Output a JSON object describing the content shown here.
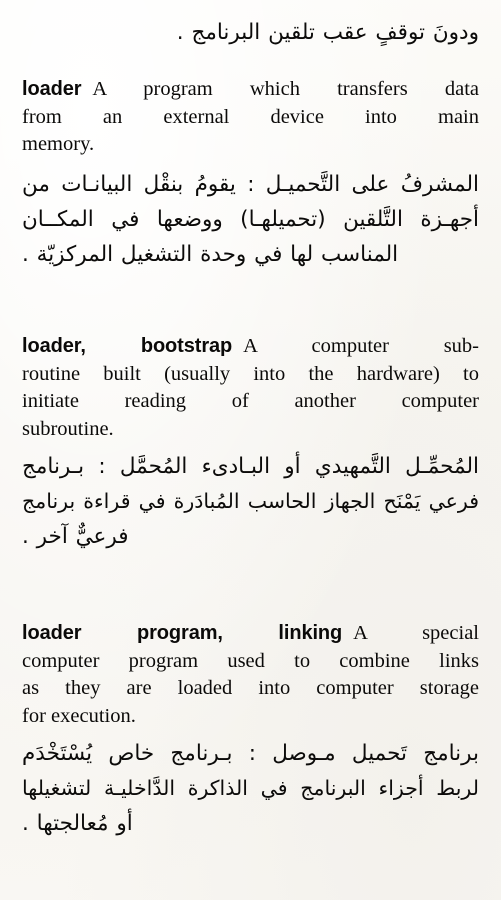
{
  "page": {
    "type": "bilingual-dictionary-page",
    "language_pair": "English-Arabic",
    "paper_color": "#f8f6f1",
    "ink_color": "#0b0a09"
  },
  "continuation": {
    "arabic_line": "ودونَ توقفٍ عقب تلقين البرنامج ."
  },
  "entries": [
    {
      "id": "loader",
      "headword": "loader",
      "english_lines": [
        "A program which transfers data",
        "from an external device into main",
        "memory."
      ],
      "english_text": "A program which transfers data from an external device into main memory.",
      "arabic_lines": [
        "المشرفُ على التَّحميـل : يقومُ بنقْل البيانـات من",
        "أجهـزة التَّلقين (تحميلهـا) ووضعها في المكــان",
        "المناسب لها في وحدة التشغيل المركزيّة ."
      ],
      "arabic_text": "المشرفُ على التَّحميل : يقومُ بنقْل البيانات من أجهزة التَّلقين (تحميلها) ووضعها في المكان المناسب لها في وحدة التشغيل المركزيّة ."
    },
    {
      "id": "loader-bootstrap",
      "headword": "loader, bootstrap",
      "english_lines": [
        "A computer sub-",
        "routine built (usually into the hardware) to",
        "initiate reading of another computer",
        "subroutine."
      ],
      "english_text": "A computer subroutine built (usually into the hardware) to initiate reading of another computer subroutine.",
      "arabic_lines": [
        "المُحمِّـل التَّمهيدي أو البـادىء المُحمَّل : بـرنامج",
        "فرعي يَمْنَح الجهاز الحاسب المُبادَرة في قراءة برنامج",
        "فرعيٌّ آخر ."
      ],
      "arabic_text": "المُحمِّل التَّمهيدي أو البادىء المُحمَّل : برنامج فرعي يَمْنَح الجهاز الحاسب المُبادَرة في قراءة برنامج فرعيٌّ آخر ."
    },
    {
      "id": "loader-program-linking",
      "headword": "loader program, linking",
      "english_lines": [
        "A special",
        "computer program used to combine links",
        "as they are loaded into computer storage",
        "for execution."
      ],
      "english_text": "A special computer program used to combine links as they are loaded into computer storage for execution.",
      "arabic_lines": [
        "برنامج تَحميل مـوصل : بـرنامج خاص يُسْتَخْدَم",
        "لربط أجزاء البرنامج في الذاكرة الدَّاخليـة لتشغيلها",
        "أو مُعالجتها ."
      ],
      "arabic_text": "برنامج تَحميل موصل : برنامج خاص يُسْتَخْدَم لربط أجزاء البرنامج في الذاكرة الدَّاخلية لتشغيلها أو مُعالجتها ."
    }
  ]
}
